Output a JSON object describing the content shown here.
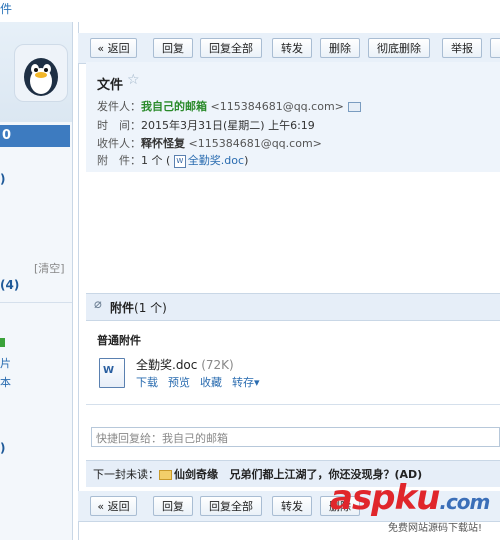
{
  "top": {
    "crumb": "件",
    "title": "… 邮件 …"
  },
  "sidebar": {
    "active_folder": "0",
    "item_b": ")",
    "clear": "[清空]",
    "count": "(4)",
    "link_a": "片",
    "link_b": "本",
    "item_c": ")"
  },
  "toolbar": {
    "back": "« 返回",
    "reply": "回复",
    "reply_all": "回复全部",
    "forward": "转发",
    "delete": "删除",
    "delete_permanent": "彻底删除",
    "report": "举报"
  },
  "email": {
    "subject": "文件",
    "from_label": "发件人：",
    "from_name": "我自己的邮箱",
    "from_addr": "<115384681@qq.com>",
    "time_label": "时　间：",
    "time_value": "2015年3月31日(星期二) 上午6:19",
    "to_label": "收件人：",
    "to_name": "释怀怪复",
    "to_addr": "<115384681@qq.com>",
    "att_label": "附　件：",
    "att_count_prefix": "1 个 (",
    "att_name": "全勤奖.doc",
    "att_count_suffix": ")"
  },
  "attachments": {
    "header_bold": "附件",
    "header_count": "(1 个)",
    "normal_label": "普通附件",
    "file_name": "全勤奖.doc",
    "file_size": "(72K)",
    "actions": [
      "下载",
      "预览",
      "收藏",
      "转存▾"
    ]
  },
  "reply": {
    "placeholder": "快捷回复给：我自己的邮箱"
  },
  "next": {
    "label": "下一封未读：",
    "sender": "仙剑奇缘",
    "subject": "兄弟们都上江湖了，你还没现身？(AD)"
  },
  "watermark": {
    "main": "aspku",
    "dot": ".com",
    "sub": "免费网站源码下载站!"
  },
  "colors": {
    "accent": "#3d7bc0",
    "sender_green": "#2a8a2a",
    "link": "#2a6cb0",
    "watermark": "#e0262b"
  }
}
